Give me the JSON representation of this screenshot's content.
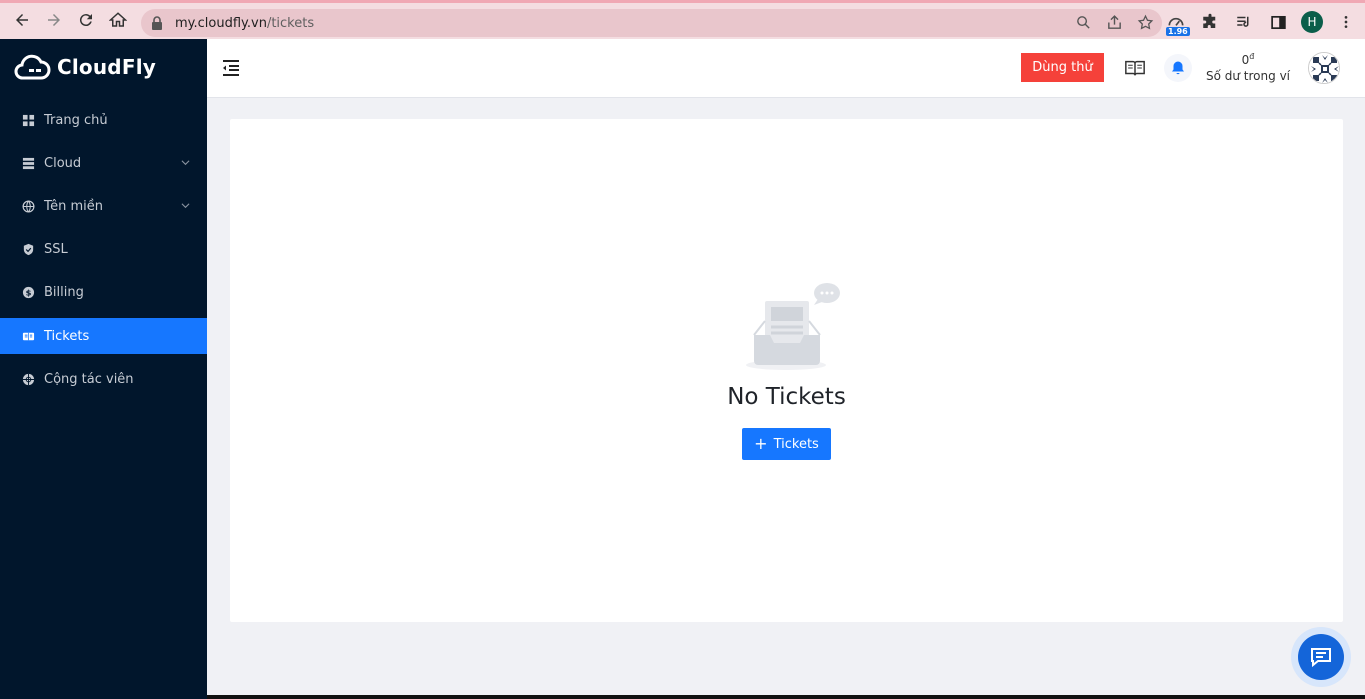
{
  "browser": {
    "url_host": "my.cloudfly.vn",
    "url_path": "/tickets",
    "extension_badge": "1.96",
    "profile_initial": "H"
  },
  "brand": {
    "name": "CloudFly"
  },
  "sidebar": {
    "items": [
      {
        "label": "Trang chủ",
        "icon": "dashboard-icon",
        "has_submenu": false
      },
      {
        "label": "Cloud",
        "icon": "server-icon",
        "has_submenu": true
      },
      {
        "label": "Tên miền",
        "icon": "globe-icon",
        "has_submenu": true
      },
      {
        "label": "SSL",
        "icon": "shield-icon",
        "has_submenu": false
      },
      {
        "label": "Billing",
        "icon": "dollar-icon",
        "has_submenu": false
      },
      {
        "label": "Tickets",
        "icon": "ticket-icon",
        "has_submenu": false,
        "active": true
      },
      {
        "label": "Cộng tác viên",
        "icon": "network-icon",
        "has_submenu": false
      }
    ]
  },
  "header": {
    "trial_label": "Dùng thử",
    "balance_amount": "0",
    "balance_currency": "đ",
    "balance_label": "Số dư trong ví"
  },
  "main": {
    "empty_title": "No Tickets",
    "add_button_label": "Tickets"
  },
  "colors": {
    "sidebar_bg": "#01162c",
    "accent": "#1677ff",
    "trial_red": "#f5413a"
  }
}
